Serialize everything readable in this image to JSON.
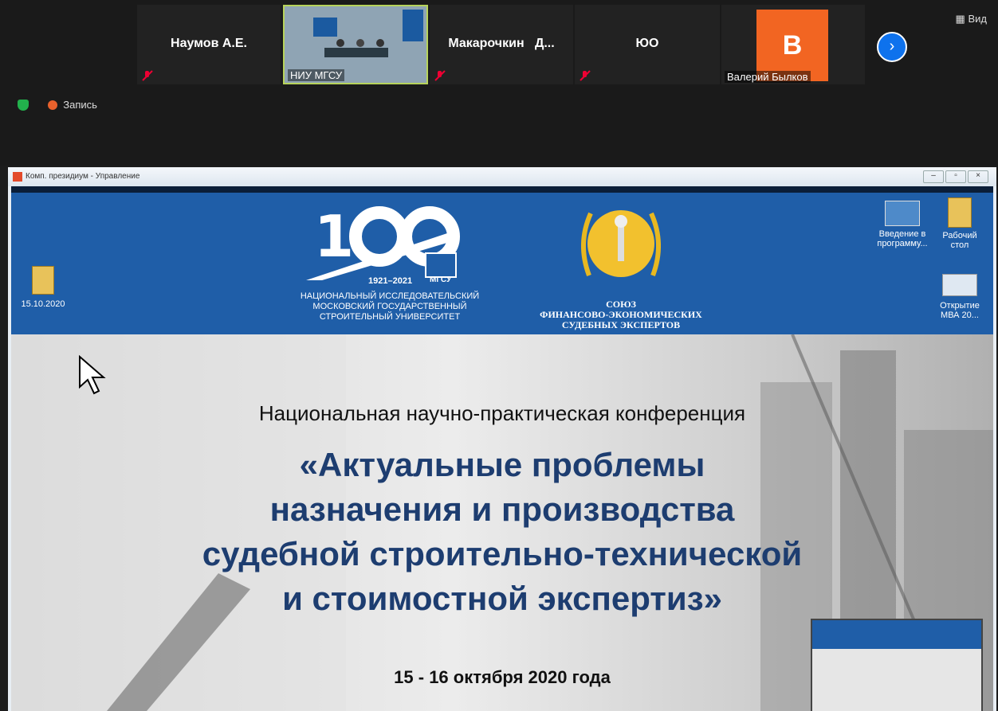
{
  "participants": [
    {
      "name": "Наумов А.Е.",
      "muted": true
    },
    {
      "name": "НИУ МГСУ",
      "muted": false
    },
    {
      "name": "Макарочкин   Д...",
      "muted": true
    },
    {
      "name": "ЮО",
      "muted": true
    },
    {
      "name": "Валерий Былков",
      "avatar_letter": "B",
      "avatar_color": "#f26522"
    }
  ],
  "view_label": "Вид",
  "record_label": "Запись",
  "window_title": "Комп. президиум - Управление",
  "desktop_icons": {
    "left": "15.10.2020",
    "right1": "Введение в программу...",
    "right2": "Рабочий стол",
    "right3": "Открытие МВА 20..."
  },
  "logo100": {
    "years": "1921–2021",
    "badge": "МГСУ",
    "org_line1": "НАЦИОНАЛЬНЫЙ ИССЛЕДОВАТЕЛЬСКИЙ",
    "org_line2": "МОСКОВСКИЙ ГОСУДАРСТВЕННЫЙ",
    "org_line3": "СТРОИТЕЛЬНЫЙ УНИВЕРСИТЕТ"
  },
  "union": {
    "line1": "СОЮЗ",
    "line2": "ФИНАНСОВО-ЭКОНОМИЧЕСКИХ",
    "line3": "СУДЕБНЫХ ЭКСПЕРТОВ"
  },
  "slide": {
    "subtitle": "Национальная научно-практическая конференция",
    "title1": "«Актуальные проблемы",
    "title2": "назначения и производства",
    "title3": "судебной строительно-технической",
    "title4": "и стоимостной экспертиз»",
    "dates": "15 - 16 октября 2020 года"
  },
  "colors": {
    "accent": "#0e72ed",
    "slide_blue": "#1f5ea8",
    "title_blue": "#1d3d70"
  }
}
